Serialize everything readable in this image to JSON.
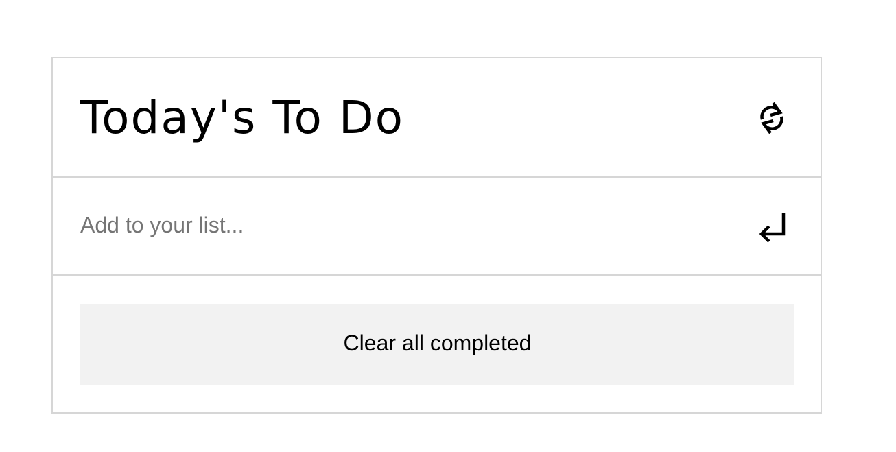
{
  "header": {
    "title": "Today's To Do",
    "refresh_icon": "refresh-icon"
  },
  "add_item": {
    "value": "",
    "placeholder": "Add to your list...",
    "submit_icon": "enter-icon"
  },
  "footer": {
    "clear_label": "Clear all completed"
  },
  "colors": {
    "border": "#d6d6d6",
    "button_bg": "#f2f2f2",
    "placeholder": "#757575",
    "text": "#000000"
  }
}
